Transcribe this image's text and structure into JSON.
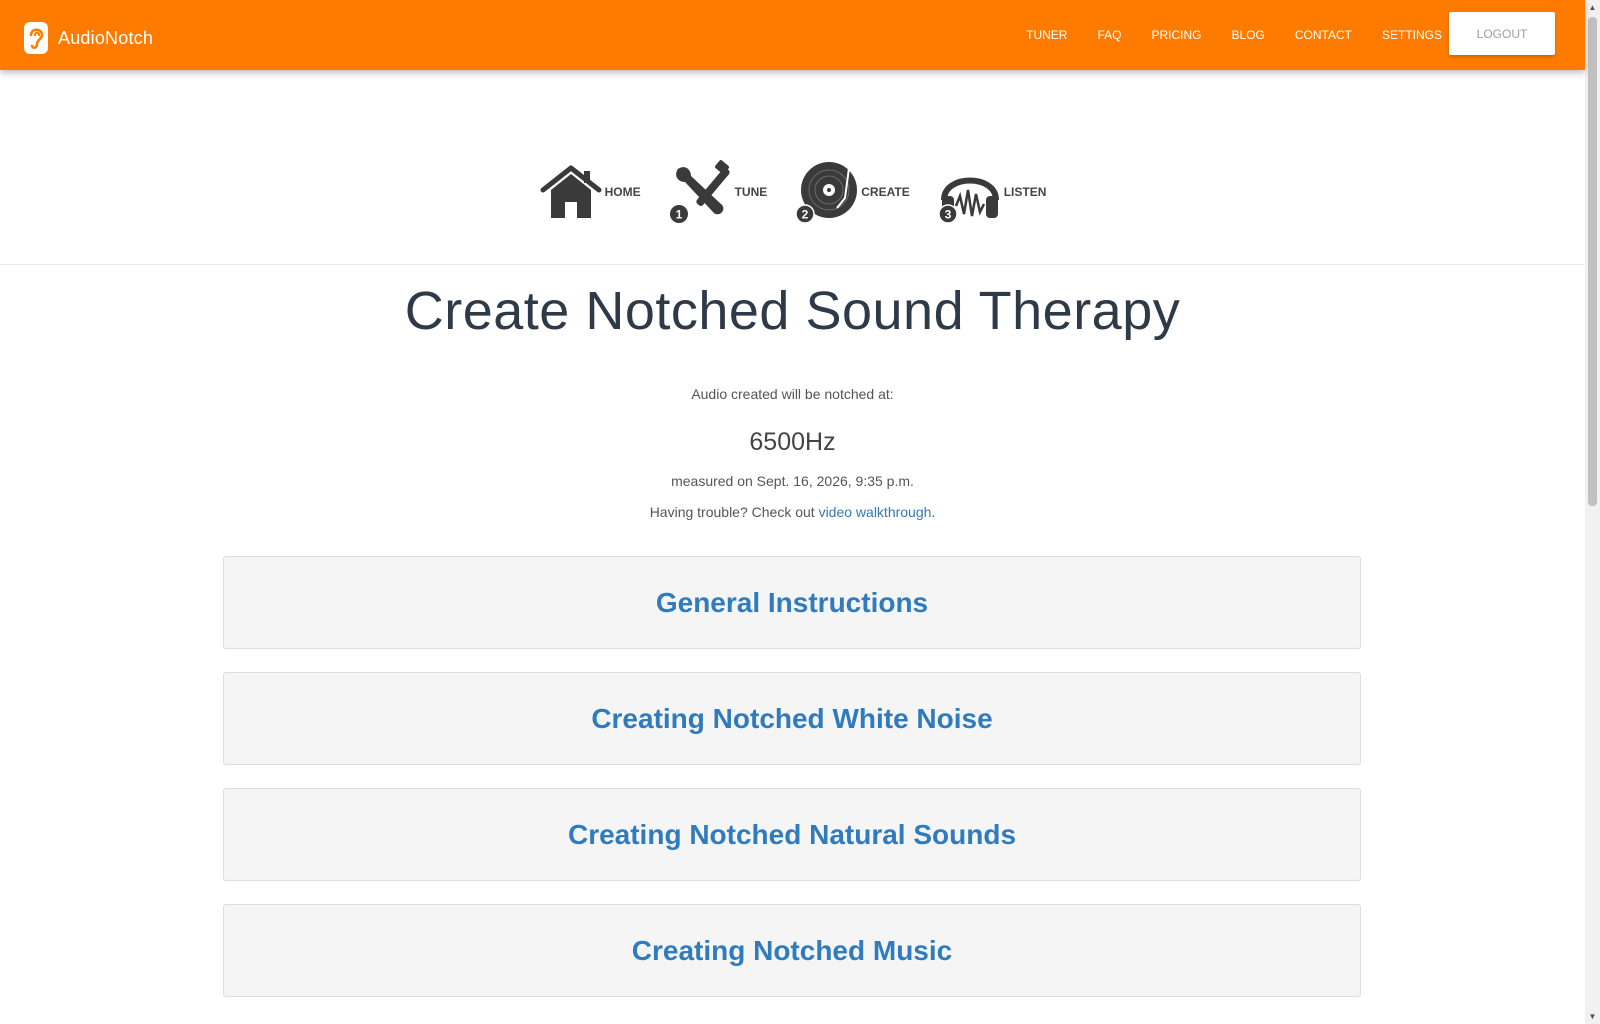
{
  "navbar": {
    "brand": "AudioNotch",
    "links": [
      "TUNER",
      "FAQ",
      "PRICING",
      "BLOG",
      "CONTACT",
      "SETTINGS"
    ],
    "logout_label": "LOGOUT",
    "background_color": "#ff7b00"
  },
  "steps": [
    {
      "label": "HOME",
      "icon": "home-icon"
    },
    {
      "label": "TUNE",
      "icon": "tools-icon",
      "number": "1"
    },
    {
      "label": "CREATE",
      "icon": "disc-icon",
      "number": "2"
    },
    {
      "label": "LISTEN",
      "icon": "headphones-icon",
      "number": "3"
    }
  ],
  "main": {
    "title": "Create Notched Sound Therapy",
    "notched_label": "Audio created will be notched at:",
    "frequency": "6500Hz",
    "measured": "measured on Sept. 16, 2026, 9:35 p.m.",
    "trouble_prefix": "Having trouble? Check out ",
    "trouble_link": "video walkthrough",
    "trouble_suffix": ".",
    "panels": [
      "General Instructions",
      "Creating Notched White Noise",
      "Creating Notched Natural Sounds",
      "Creating Notched Music"
    ]
  },
  "colors": {
    "accent": "#ff7b00",
    "link": "#337ab7",
    "panel_title": "#2f7bbd"
  }
}
